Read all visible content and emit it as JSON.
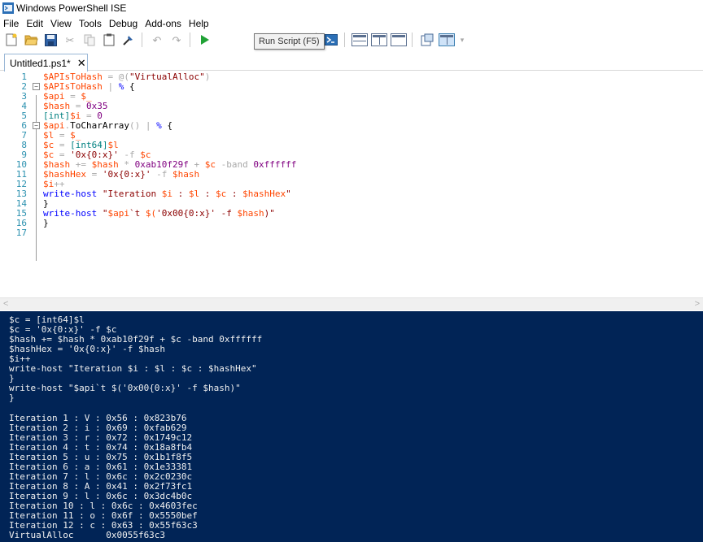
{
  "window": {
    "title": "Windows PowerShell ISE"
  },
  "menu": [
    "File",
    "Edit",
    "View",
    "Tools",
    "Debug",
    "Add-ons",
    "Help"
  ],
  "toolbar": {
    "icons": [
      "new-file-icon",
      "open-folder-icon",
      "save-icon",
      "cut-icon",
      "copy-icon",
      "paste-icon",
      "clear-console-icon",
      "undo-icon",
      "redo-icon",
      "run-script-icon",
      "run-selection-icon",
      "powershell-tab-icon",
      "layout-top-icon",
      "layout-right-icon",
      "layout-max-icon",
      "show-console-icon",
      "show-script-icon"
    ],
    "tooltip": "Run Script (F5)"
  },
  "tab": {
    "label": "Untitled1.ps1*"
  },
  "editor": {
    "line_numbers": [
      "1",
      "2",
      "3",
      "4",
      "5",
      "6",
      "7",
      "8",
      "9",
      "10",
      "11",
      "12",
      "13",
      "14",
      "15",
      "16",
      "17"
    ],
    "lines": [
      "$APIsToHash = @(\"VirtualAlloc\")",
      "$APIsToHash | % {",
      "$api = $_",
      "$hash = 0x35",
      "[int]$i = 0",
      "$api.ToCharArray() | % {",
      "$l = $_",
      "$c = [int64]$l",
      "$c = '0x{0:x}' -f $c",
      "$hash += $hash * 0xab10f29f + $c -band 0xffffff",
      "$hashHex = '0x{0:x}' -f $hash",
      "$i++",
      "write-host \"Iteration $i : $l : $c : $hashHex\"",
      "}",
      "write-host \"$api`t $('0x00{0:x}' -f $hash)\"",
      "}",
      ""
    ]
  },
  "console": {
    "lines": [
      "$c = [int64]$l",
      "$c = '0x{0:x}' -f $c",
      "$hash += $hash * 0xab10f29f + $c -band 0xffffff",
      "$hashHex = '0x{0:x}' -f $hash",
      "$i++",
      "write-host \"Iteration $i : $l : $c : $hashHex\"",
      "}",
      "write-host \"$api`t $('0x00{0:x}' -f $hash)\"",
      "}",
      "",
      "Iteration 1 : V : 0x56 : 0x823b76",
      "Iteration 2 : i : 0x69 : 0xfab629",
      "Iteration 3 : r : 0x72 : 0x1749c12",
      "Iteration 4 : t : 0x74 : 0x18a8fb4",
      "Iteration 5 : u : 0x75 : 0x1b1f8f5",
      "Iteration 6 : a : 0x61 : 0x1e33381",
      "Iteration 7 : l : 0x6c : 0x2c0230c",
      "Iteration 8 : A : 0x41 : 0x2f73fc1",
      "Iteration 9 : l : 0x6c : 0x3dc4b0c",
      "Iteration 10 : l : 0x6c : 0x4603fec",
      "Iteration 11 : o : 0x6f : 0x5550bef",
      "Iteration 12 : c : 0x63 : 0x55f63c3",
      "VirtualAlloc      0x0055f63c3"
    ]
  },
  "colors": {
    "console_bg": "#012456",
    "variable": "#ff4500",
    "string": "#8b0000",
    "number": "#800080",
    "operator": "#a9a9a9",
    "command": "#0000ff",
    "line_number": "#2b91af"
  }
}
